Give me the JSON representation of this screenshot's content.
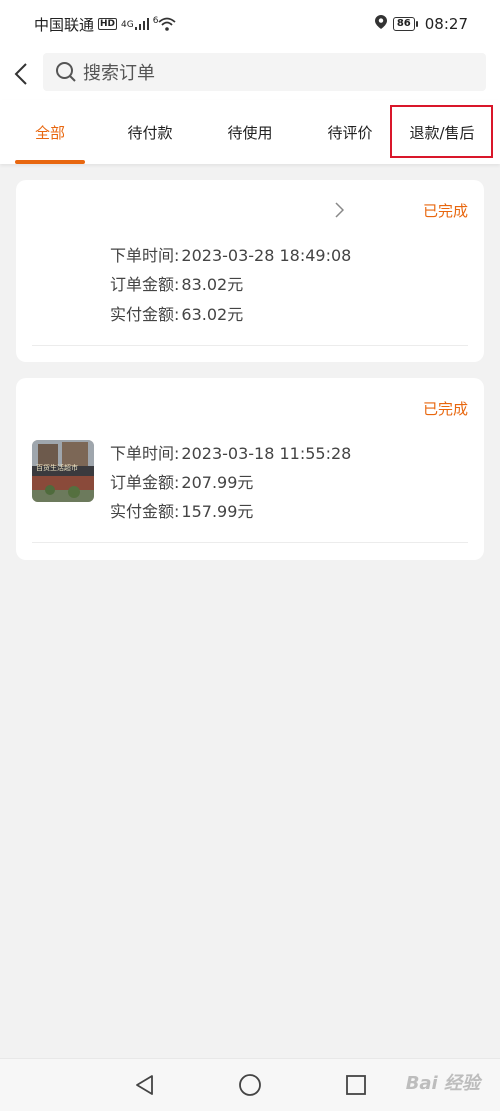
{
  "status_bar": {
    "carrier": "中国联通",
    "hd": "HD",
    "network": "4G",
    "wifi_badge": "6",
    "battery": "86",
    "time": "08:27"
  },
  "header": {
    "search_placeholder": "搜索订单",
    "icons": [
      "back-arrow-icon",
      "search-icon"
    ]
  },
  "tabs": [
    {
      "label": "全部",
      "active": true
    },
    {
      "label": "待付款",
      "active": false
    },
    {
      "label": "待使用",
      "active": false
    },
    {
      "label": "待评价",
      "active": false
    },
    {
      "label": "退款/售后",
      "active": false,
      "highlighted": true
    }
  ],
  "orders": [
    {
      "status": "已完成",
      "order_time_label": "下单时间:",
      "order_time": "2023-03-28 18:49:08",
      "order_amount_label": "订单金额:",
      "order_amount": "83.02元",
      "paid_amount_label": "实付金额:",
      "paid_amount": "63.02元"
    },
    {
      "status": "已完成",
      "order_time_label": "下单时间:",
      "order_time": "2023-03-18 11:55:28",
      "order_amount_label": "订单金额:",
      "order_amount": "207.99元",
      "paid_amount_label": "实付金额:",
      "paid_amount": "157.99元",
      "thumb_text": "百货生活超市"
    }
  ],
  "nav_bar": {
    "icons": [
      "back-triangle-icon",
      "home-circle-icon",
      "recents-square-icon"
    ],
    "watermark": "Bai 经验"
  },
  "colors": {
    "accent": "#e8670f",
    "highlight_border": "#d9172a",
    "page_bg": "#f2f2f2"
  }
}
